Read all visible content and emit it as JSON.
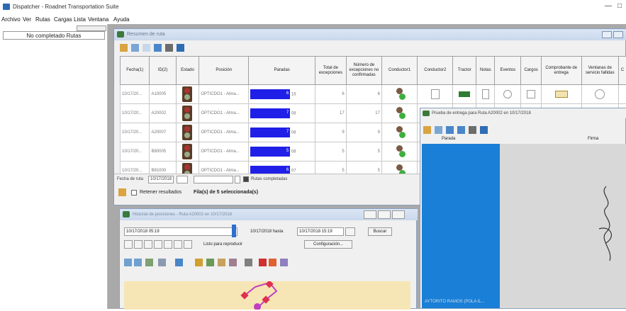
{
  "app": {
    "title": "Dispatcher - Roadnet Transportation Suite",
    "minimize": "—",
    "maximize": "□"
  },
  "menu": [
    "Archivo",
    "Ver",
    "Rutas",
    "Cargas",
    "Lista",
    "Ventana",
    "Ayuda"
  ],
  "left_panel": {
    "selected": "No completado Rutas"
  },
  "routes_window": {
    "title": "Resumen de ruta",
    "columns": [
      "Fecha(1)",
      "ID(2)",
      "Estado",
      "Posición",
      "Paradas",
      "Total de excepciones",
      "Número de excepciones no confirmadas",
      "Conductor1",
      "Conductor2",
      "Tractor",
      "Notas",
      "Eventos",
      "Cargos",
      "Comprobante de entrega",
      "Ventanas de servicio fallidas",
      "C"
    ],
    "rows": [
      {
        "fecha": "10/17/20...",
        "id": "A10005",
        "posicion": "OPTICDO1 - Alma...",
        "paradas": 6,
        "paradas_pct": 0.82,
        "paradas_label": "6",
        "total_tag": "16",
        "total": 6,
        "noconf": 6
      },
      {
        "fecha": "10/17/20...",
        "id": "A20002",
        "posicion": "OPTICDO1 - Alma...",
        "paradas": 7,
        "paradas_pct": 0.82,
        "paradas_label": "7",
        "total_tag": "08",
        "total": 17,
        "noconf": 17
      },
      {
        "fecha": "10/17/20...",
        "id": "A20007",
        "posicion": "OPTICDO1 - Alma...",
        "paradas": 7,
        "paradas_pct": 0.82,
        "paradas_label": "7",
        "total_tag": "08",
        "total": 9,
        "noconf": 9
      },
      {
        "fecha": "10/17/20...",
        "id": "B80005",
        "posicion": "OPTICDO1 - Alma...",
        "paradas": 5,
        "paradas_pct": 0.82,
        "paradas_label": "5",
        "total_tag": "08",
        "total": 5,
        "noconf": 5
      },
      {
        "fecha": "10/17/20...",
        "id": "B81000",
        "posicion": "OPTICDO1 - Alma...",
        "paradas": 6,
        "paradas_pct": 0.82,
        "paradas_label": "6",
        "total_tag": "07",
        "total": 5,
        "noconf": 5
      }
    ],
    "date_label": "Fecha de ruta",
    "date_value": "10/17/2018",
    "completed_label": "Rutas completadas",
    "retain_label": "Retener resultados",
    "status": "Fila(s) de 5 seleccionada(s)"
  },
  "history_window": {
    "title": "Historial de posiciones - Ruta A20002 en 10/17/2018",
    "start": "10/17/2018 05:19",
    "hasta": "10/17/2018 hasta",
    "end": "10/17/2018 15:19",
    "search": "Buscar",
    "ready": "Listo para reproducir",
    "config": "Configuración..."
  },
  "delivery_window": {
    "title": "Prueba de entrega para Ruta A20002 en 10/17/2018",
    "col_stop": "Parada",
    "col_sign": "Firma",
    "stop_label": "AYTORITO RAMOS (POLA IL..."
  },
  "colors": {
    "bar": "#1f1fe8",
    "blue_panel": "#1a7fd6",
    "map": "#f7e6b5"
  }
}
